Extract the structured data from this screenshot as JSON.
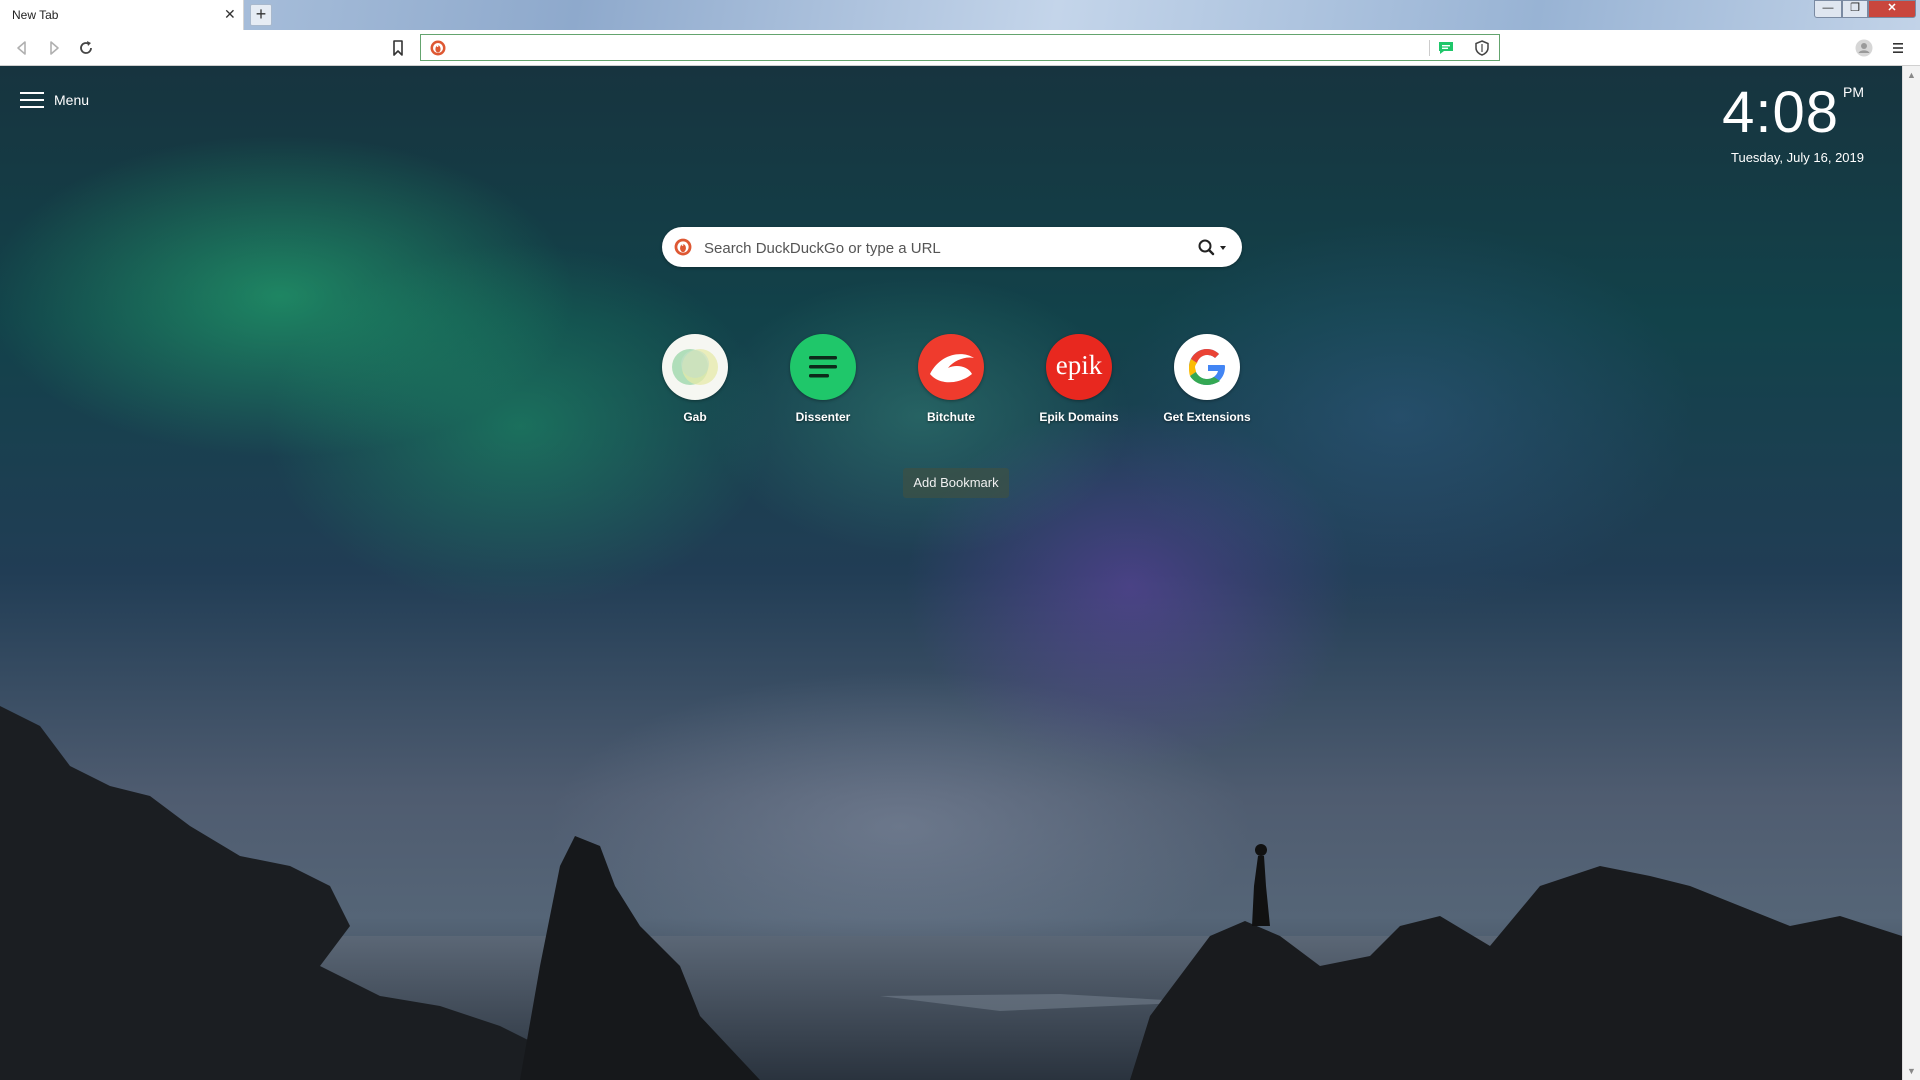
{
  "browser": {
    "tab": {
      "title": "New Tab",
      "close_glyph": "✕"
    },
    "new_tab_glyph": "+",
    "window_controls": {
      "minimize": "—",
      "maximize": "❐",
      "close": "✕"
    },
    "address_bar": {
      "value": "",
      "placeholder": ""
    },
    "icons": [
      "back-icon",
      "forward-icon",
      "reload-icon",
      "bookmark-icon",
      "duckduckgo-icon",
      "chat-icon",
      "shield-icon",
      "profile-icon",
      "menu-icon"
    ],
    "accent_color": "#64a46e"
  },
  "page": {
    "menu": {
      "label": "Menu"
    },
    "clock": {
      "time": "4:08",
      "ampm": "PM",
      "date": "Tuesday, July 16, 2019"
    },
    "search": {
      "placeholder": "Search DuckDuckGo or type a URL"
    },
    "tiles": [
      {
        "label": "Gab",
        "glyph": ""
      },
      {
        "label": "Dissenter",
        "glyph": ""
      },
      {
        "label": "Bitchute",
        "glyph": ""
      },
      {
        "label": "Epik Domains",
        "glyph": "epik"
      },
      {
        "label": "Get Extensions",
        "glyph": ""
      }
    ],
    "add_bookmark": "Add Bookmark",
    "colors": {
      "dissenter": "#1fc76a",
      "bitchute": "#ef3b2d",
      "epik": "#e8281f",
      "ddg": "#de5833"
    }
  }
}
